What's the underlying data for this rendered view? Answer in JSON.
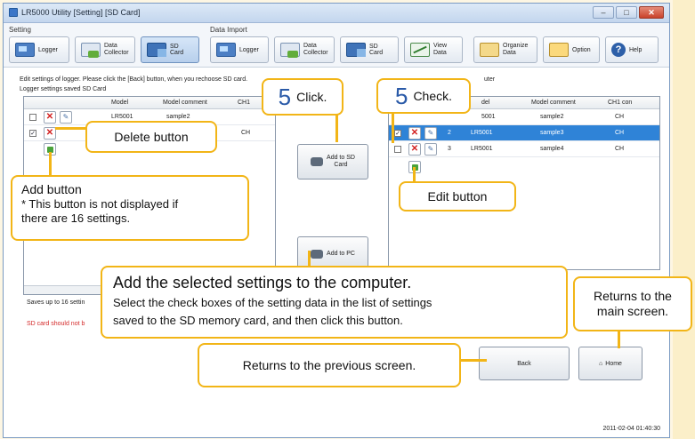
{
  "window": {
    "title": "LR5000 Utility [Setting] [SD Card]"
  },
  "toolbar": {
    "setting_label": "Setting",
    "data_import_label": "Data Import",
    "buttons": {
      "logger": "Logger",
      "data_collector": "Data\nCollector",
      "sd_card": "SD Card",
      "logger2": "Logger",
      "data_collector2": "Data\nCollector",
      "sd_card2": "SD Card",
      "view_data": "View\nData",
      "organize_data": "Organize\nData",
      "option": "Option",
      "help": "Help"
    }
  },
  "instructions": "Edit settings of logger. Please click the [Back] button, when you rechoose SD card.",
  "left_panel": {
    "title": "Logger settings saved SD Card",
    "columns": [
      "Model",
      "Model comment",
      "CH1"
    ],
    "rows": [
      {
        "model": "LR5001",
        "comment": "sample2",
        "checked": false
      },
      {
        "model": "",
        "comment": "",
        "ch1": "CH",
        "checked": true
      }
    ]
  },
  "right_panel": {
    "title_fragment": "uter",
    "columns": [
      "del",
      "Model comment",
      "CH1 con"
    ],
    "rows": [
      {
        "no": "",
        "model": "5001",
        "comment": "sample2",
        "ch1": "CH",
        "selected": false,
        "checked": false
      },
      {
        "no": "2",
        "model": "LR5001",
        "comment": "sample3",
        "ch1": "CH",
        "selected": true,
        "checked": true
      },
      {
        "no": "3",
        "model": "LR5001",
        "comment": "sample4",
        "ch1": "CH",
        "selected": false,
        "checked": false
      }
    ]
  },
  "middle": {
    "add_to_sd_label": "Add to SD\nCard",
    "add_to_pc_label": "Add to PC"
  },
  "footer": {
    "saves_note": "Saves up to 16 settin",
    "sd_warning": "SD card should not b",
    "back_label": "Back",
    "home_label": "Home",
    "timestamp": "2011-02-04 01:40:30"
  },
  "callouts": {
    "click": {
      "num": "5",
      "text": "Click."
    },
    "check": {
      "num": "5",
      "text": "Check."
    },
    "delete": "Delete button",
    "add_title": "Add button",
    "add_note": "* This button is not displayed if\n   there are 16 settings.",
    "edit": "Edit button",
    "add_pc_title": "Add the selected settings to the computer.",
    "add_pc_body": "Select the check boxes of the setting data in the list of settings\nsaved to the SD memory card, and then click this button.",
    "returns_main": "Returns to the\nmain screen.",
    "returns_prev": "Returns to the previous screen."
  },
  "colors": {
    "accent": "#f2b517",
    "selection": "#2f83d7",
    "step_number": "#2a5aa8",
    "warning_text": "#d42a2a"
  }
}
